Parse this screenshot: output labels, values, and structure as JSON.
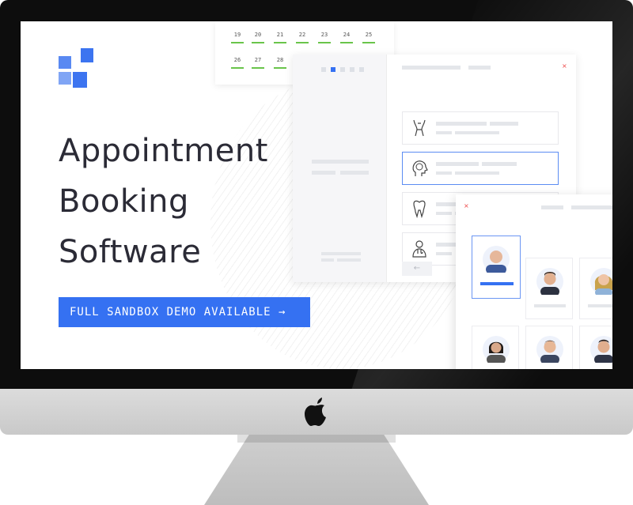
{
  "banner": {
    "headline_line1": "Appointment",
    "headline_line2": "Booking",
    "headline_line3": "Software",
    "cta_label": "FULL SANDBOX DEMO AVAILABLE →"
  },
  "calendar": {
    "row1": [
      "19",
      "20",
      "21",
      "22",
      "23",
      "24",
      "25"
    ],
    "row2": [
      "26",
      "27",
      "28"
    ]
  },
  "panel": {
    "close_glyph": "×"
  },
  "staff_panel": {
    "close_glyph": "×"
  },
  "back_button": {
    "glyph": "←"
  },
  "colors": {
    "accent": "#3571f2",
    "headline": "#2b2b36",
    "bezel": "#0d0d0d",
    "chin": "#d2d2d2",
    "calendar_bar": "#69c44a"
  },
  "icons": {
    "brand": "brand-logo",
    "services": [
      "body-icon",
      "head-brain-icon",
      "tooth-icon",
      "doctor-icon"
    ],
    "stand": "apple-logo"
  }
}
